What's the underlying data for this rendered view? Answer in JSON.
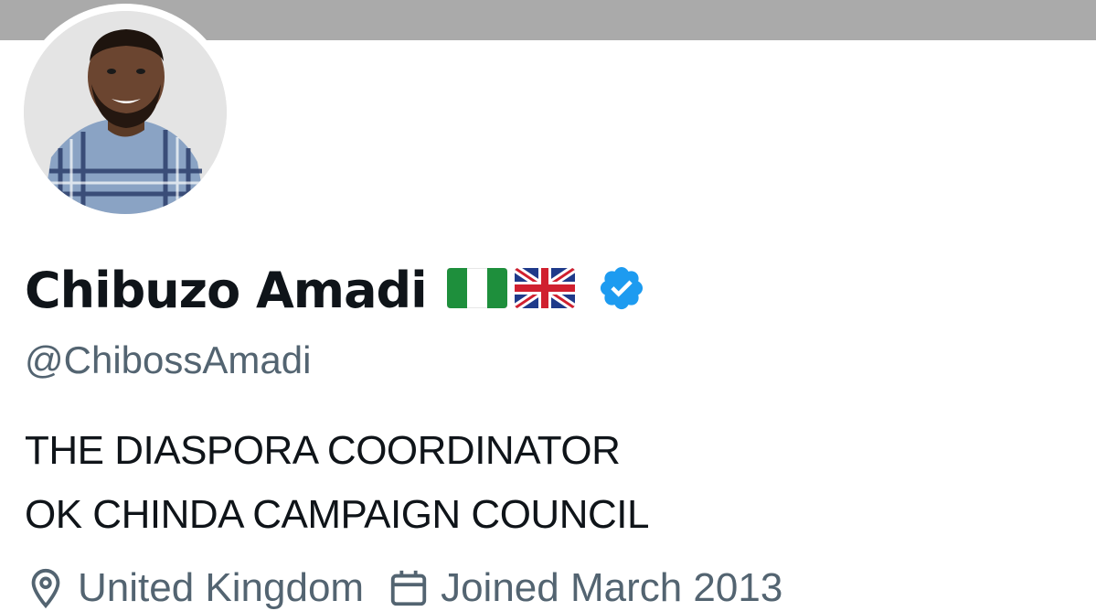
{
  "profile": {
    "display_name": "Chibuzo Amadi",
    "flags": [
      "nigeria-flag",
      "uk-flag"
    ],
    "verified_icon": "verified-badge-icon",
    "handle": "@ChibossAmadi",
    "bio_lines": [
      "THE DIASPORA COORDINATOR",
      "OK CHINDA CAMPAIGN COUNCIL"
    ],
    "location": "United Kingdom",
    "joined": "Joined March 2013"
  },
  "colors": {
    "banner": "#aaaaaa",
    "text_primary": "#0f1419",
    "text_secondary": "#536471",
    "verified_blue": "#1d9bf0"
  }
}
